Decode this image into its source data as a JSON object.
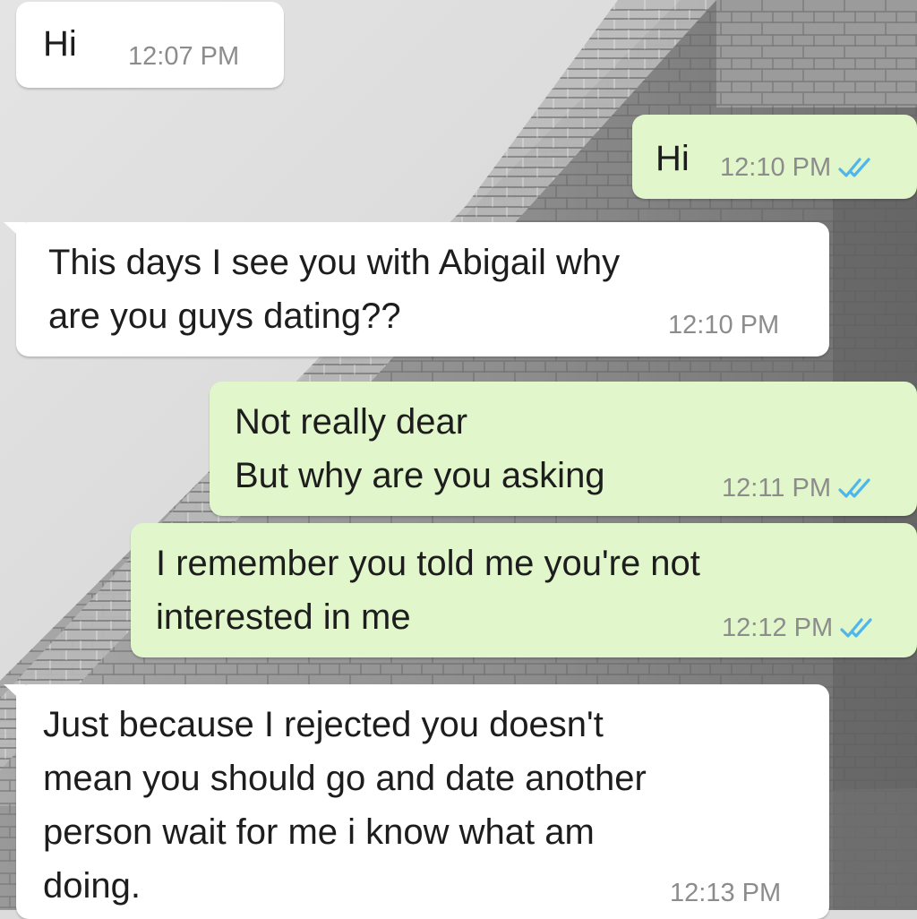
{
  "colors": {
    "incoming_bubble": "#ffffff",
    "outgoing_bubble": "#e1f6cb",
    "timestamp": "#8c8c8c",
    "read_ticks": "#4fb6ec",
    "text": "#1d1d1d"
  },
  "messages": [
    {
      "direction": "incoming",
      "text": "Hi",
      "time": "12:07 PM"
    },
    {
      "direction": "outgoing",
      "text": "Hi",
      "time": "12:10 PM",
      "status": "read-double-check-icon"
    },
    {
      "direction": "incoming",
      "text_lines": [
        "This days I see you with Abigail why",
        "are you guys dating??"
      ],
      "time": "12:10 PM"
    },
    {
      "direction": "outgoing",
      "text_lines": [
        "Not really dear",
        "But why are you asking"
      ],
      "time": "12:11 PM",
      "status": "read-double-check-icon"
    },
    {
      "direction": "outgoing",
      "text_lines": [
        "I remember you told me you're not",
        "interested in me"
      ],
      "time": "12:12 PM",
      "status": "read-double-check-icon"
    },
    {
      "direction": "incoming",
      "text_lines": [
        "Just because I rejected you doesn't",
        "mean you should go and date another",
        "person wait for me i know what am",
        "doing."
      ],
      "time": "12:13 PM"
    }
  ]
}
